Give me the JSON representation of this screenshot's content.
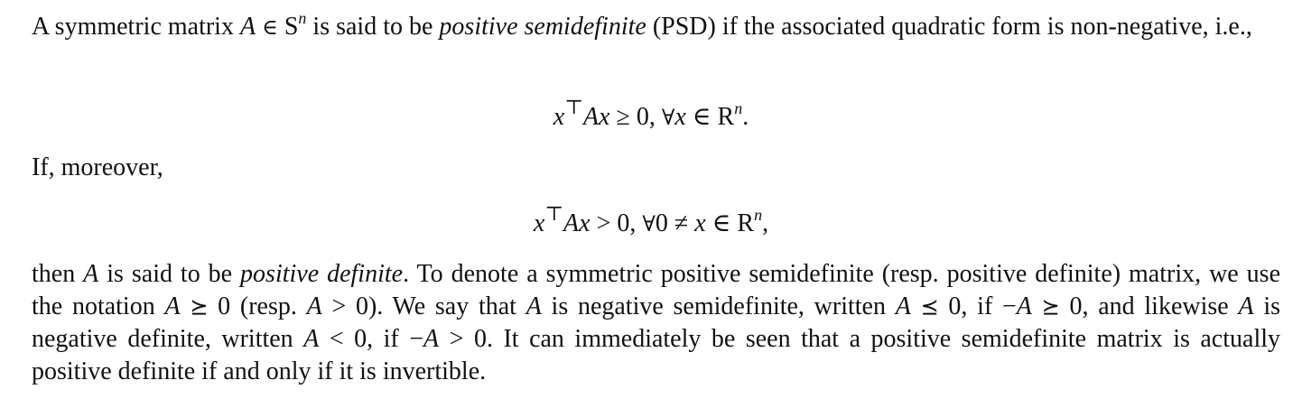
{
  "paragraph1": {
    "t1": "A symmetric matrix ",
    "A": "A",
    "in": "∈",
    "S": "S",
    "n": "n",
    "t2": " is said to be ",
    "psd_term": "positive semidefinite",
    "t3": " (PSD) if the associated quadratic form is non-negative, i.e.,"
  },
  "eq1": {
    "x": "x",
    "T": "⊤",
    "Ax": "Ax",
    "rel": " ≥ 0, ",
    "forall": "∀",
    "x2": "x",
    "in": " ∈ ",
    "R": "R",
    "n": "n",
    "end": "."
  },
  "paragraph2": {
    "text": "If, moreover,"
  },
  "eq2": {
    "x": "x",
    "T": "⊤",
    "Ax": "Ax",
    "rel": " > 0, ",
    "forall": "∀",
    "zero": "0",
    "neq": " ≠ ",
    "x2": "x",
    "in": " ∈ ",
    "R": "R",
    "n": "n",
    "end": ","
  },
  "paragraph3": {
    "s1": "then ",
    "A1": "A",
    "s2": " is said to be ",
    "pd_term": "positive definite",
    "s3": ". To denote a symmetric positive semidefinite (resp. positive definite) matrix, we use the notation ",
    "A2": "A",
    "succeq1": "⪰",
    "s4": " 0 (resp. ",
    "A3": "A",
    "s5": " > 0). We say that ",
    "A4": "A",
    "s6": " is negative semidefinite, written ",
    "A5": "A",
    "preceq": "⪯",
    "s7": " 0, if −",
    "A6": "A",
    "succeq2": "⪰",
    "s8": " 0, and likewise ",
    "A7": "A",
    "s9": " is negative definite, written ",
    "A8": "A",
    "s10": " < 0, if −",
    "A9": "A",
    "s11": " > 0. It can immediately be seen that a positive semidefinite matrix is actually positive definite if and only if it is invertible."
  }
}
